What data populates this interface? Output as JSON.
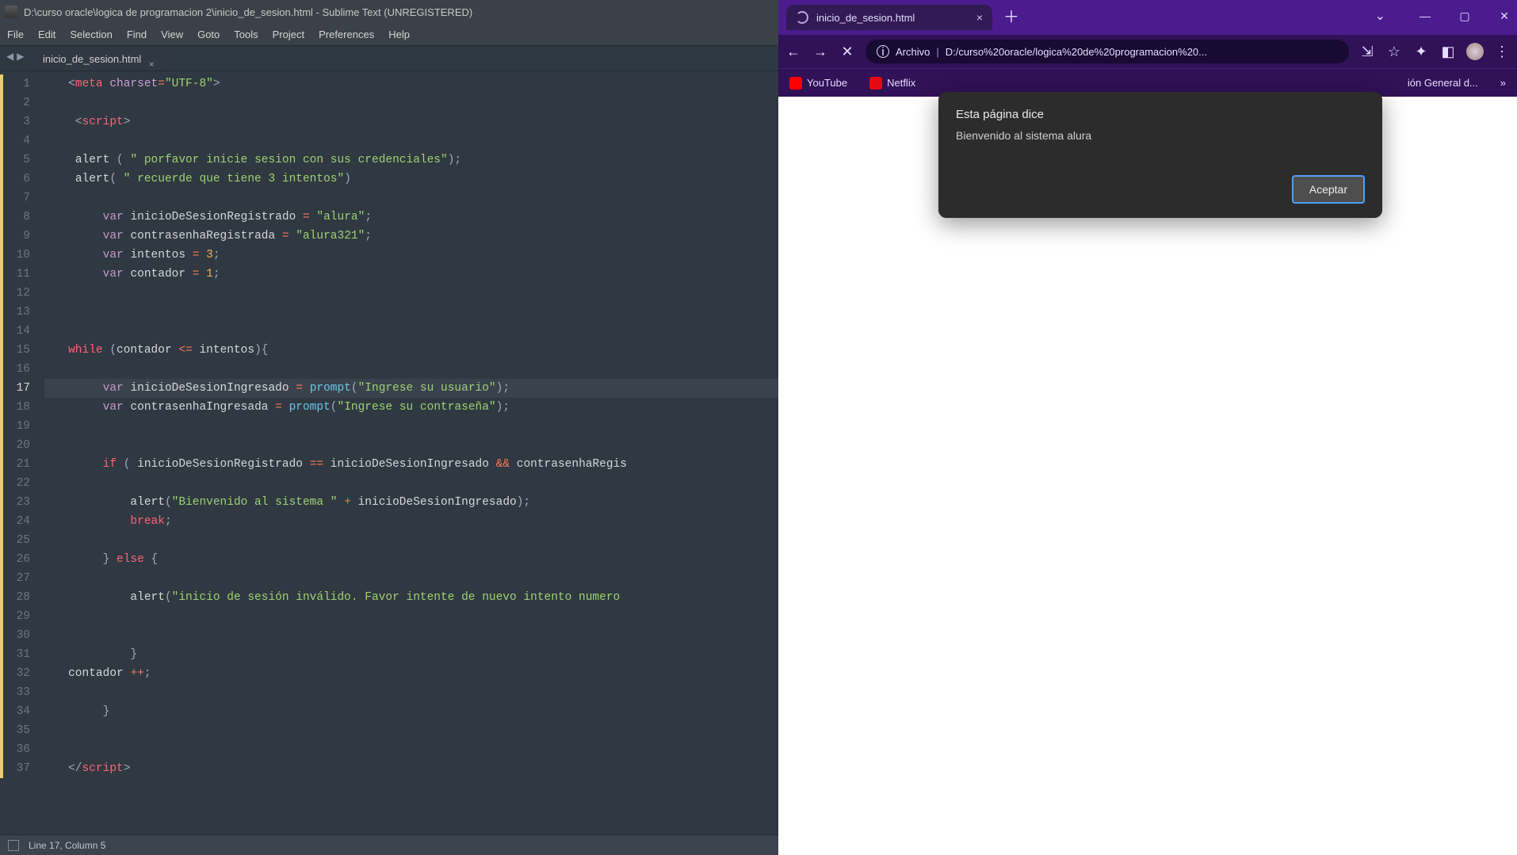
{
  "sublime": {
    "title": "D:\\curso oracle\\logica de programacion 2\\inicio_de_sesion.html - Sublime Text (UNREGISTERED)",
    "menus": [
      "File",
      "Edit",
      "Selection",
      "Find",
      "View",
      "Goto",
      "Tools",
      "Project",
      "Preferences",
      "Help"
    ],
    "tab_label": "inicio_de_sesion.html",
    "lines": 37,
    "current_line": 17,
    "mod_bars": [
      [
        1,
        8
      ],
      [
        9,
        15
      ],
      [
        16,
        17
      ],
      [
        18,
        37
      ]
    ],
    "status": {
      "cursor": "Line 17, Column 5"
    },
    "code": {
      "l1": {
        "indent": "   ",
        "parts": [
          [
            "<",
            "punc"
          ],
          [
            "meta",
            "tag"
          ],
          [
            " ",
            "punc"
          ],
          [
            "charset",
            "attr"
          ],
          [
            "=",
            "op"
          ],
          [
            "\"UTF-8\"",
            "str"
          ],
          [
            ">",
            "punc"
          ]
        ]
      },
      "l2": {
        "indent": "",
        "parts": []
      },
      "l3": {
        "indent": "    ",
        "parts": [
          [
            "<",
            "punc"
          ],
          [
            "script",
            "tag"
          ],
          [
            ">",
            "punc"
          ]
        ]
      },
      "l4": {
        "indent": "",
        "parts": []
      },
      "l5": {
        "indent": "    ",
        "parts": [
          [
            "alert",
            "ident"
          ],
          [
            " ( ",
            "punc"
          ],
          [
            "\" porfavor inicie sesion con sus credenciales\"",
            "str"
          ],
          [
            ");",
            "punc"
          ]
        ]
      },
      "l6": {
        "indent": "    ",
        "parts": [
          [
            "alert",
            "ident"
          ],
          [
            "( ",
            "punc"
          ],
          [
            "\" recuerde que tiene 3 intentos\"",
            "str"
          ],
          [
            ")",
            "punc"
          ]
        ]
      },
      "l7": {
        "indent": "",
        "parts": []
      },
      "l8": {
        "indent": "        ",
        "parts": [
          [
            "var",
            "kw"
          ],
          [
            " ",
            "punc"
          ],
          [
            "inicioDeSesionRegistrado",
            "ident"
          ],
          [
            " ",
            "punc"
          ],
          [
            "=",
            "op"
          ],
          [
            " ",
            "punc"
          ],
          [
            "\"alura\"",
            "str"
          ],
          [
            ";",
            "punc"
          ]
        ]
      },
      "l9": {
        "indent": "        ",
        "parts": [
          [
            "var",
            "kw"
          ],
          [
            " ",
            "punc"
          ],
          [
            "contrasenhaRegistrada",
            "ident"
          ],
          [
            " ",
            "punc"
          ],
          [
            "=",
            "op"
          ],
          [
            " ",
            "punc"
          ],
          [
            "\"alura321\"",
            "str"
          ],
          [
            ";",
            "punc"
          ]
        ]
      },
      "l10": {
        "indent": "        ",
        "parts": [
          [
            "var",
            "kw"
          ],
          [
            " ",
            "punc"
          ],
          [
            "intentos",
            "ident"
          ],
          [
            " ",
            "punc"
          ],
          [
            "=",
            "op"
          ],
          [
            " ",
            "punc"
          ],
          [
            "3",
            "num"
          ],
          [
            ";",
            "punc"
          ]
        ]
      },
      "l11": {
        "indent": "        ",
        "parts": [
          [
            "var",
            "kw"
          ],
          [
            " ",
            "punc"
          ],
          [
            "contador",
            "ident"
          ],
          [
            " ",
            "punc"
          ],
          [
            "=",
            "op"
          ],
          [
            " ",
            "punc"
          ],
          [
            "1",
            "num"
          ],
          [
            ";",
            "punc"
          ]
        ]
      },
      "l12": {
        "indent": "",
        "parts": []
      },
      "l13": {
        "indent": "",
        "parts": []
      },
      "l14": {
        "indent": "",
        "parts": []
      },
      "l15": {
        "indent": "   ",
        "parts": [
          [
            "while",
            "kw2"
          ],
          [
            " (",
            "punc"
          ],
          [
            "contador",
            "ident"
          ],
          [
            " ",
            "punc"
          ],
          [
            "<=",
            "op"
          ],
          [
            " ",
            "punc"
          ],
          [
            "intentos",
            "ident"
          ],
          [
            "){",
            "punc"
          ]
        ]
      },
      "l16": {
        "indent": "",
        "parts": []
      },
      "l17": {
        "indent": "        ",
        "parts": [
          [
            "var",
            "kw"
          ],
          [
            " ",
            "punc"
          ],
          [
            "inicioDeSesionIngresado",
            "ident"
          ],
          [
            " ",
            "punc"
          ],
          [
            "=",
            "op"
          ],
          [
            " ",
            "punc"
          ],
          [
            "prompt",
            "func"
          ],
          [
            "(",
            "punc"
          ],
          [
            "\"Ingrese su usuario\"",
            "str"
          ],
          [
            ");",
            "punc"
          ]
        ]
      },
      "l18": {
        "indent": "        ",
        "parts": [
          [
            "var",
            "kw"
          ],
          [
            " ",
            "punc"
          ],
          [
            "contrasenhaIngresada",
            "ident"
          ],
          [
            " ",
            "punc"
          ],
          [
            "=",
            "op"
          ],
          [
            " ",
            "punc"
          ],
          [
            "prompt",
            "func"
          ],
          [
            "(",
            "punc"
          ],
          [
            "\"Ingrese su contraseña\"",
            "str"
          ],
          [
            ");",
            "punc"
          ]
        ]
      },
      "l19": {
        "indent": "",
        "parts": []
      },
      "l20": {
        "indent": "",
        "parts": []
      },
      "l21": {
        "indent": "        ",
        "parts": [
          [
            "if",
            "kw2"
          ],
          [
            " ( ",
            "punc"
          ],
          [
            "inicioDeSesionRegistrado",
            "ident"
          ],
          [
            " ",
            "punc"
          ],
          [
            "==",
            "op"
          ],
          [
            " ",
            "punc"
          ],
          [
            "inicioDeSesionIngresado",
            "ident"
          ],
          [
            " ",
            "punc"
          ],
          [
            "&&",
            "op"
          ],
          [
            " ",
            "punc"
          ],
          [
            "contrasenhaRegis",
            "ident"
          ]
        ]
      },
      "l22": {
        "indent": "",
        "parts": []
      },
      "l23": {
        "indent": "            ",
        "parts": [
          [
            "alert",
            "ident"
          ],
          [
            "(",
            "punc"
          ],
          [
            "\"Bienvenido al sistema \"",
            "str"
          ],
          [
            " ",
            "punc"
          ],
          [
            "+",
            "op"
          ],
          [
            " ",
            "punc"
          ],
          [
            "inicioDeSesionIngresado",
            "ident"
          ],
          [
            ");",
            "punc"
          ]
        ]
      },
      "l24": {
        "indent": "            ",
        "parts": [
          [
            "break",
            "kw2"
          ],
          [
            ";",
            "punc"
          ]
        ]
      },
      "l25": {
        "indent": "",
        "parts": []
      },
      "l26": {
        "indent": "        ",
        "parts": [
          [
            "}",
            "punc"
          ],
          [
            " ",
            "punc"
          ],
          [
            "else",
            "kw2"
          ],
          [
            " {",
            "punc"
          ]
        ]
      },
      "l27": {
        "indent": "",
        "parts": []
      },
      "l28": {
        "indent": "            ",
        "parts": [
          [
            "alert",
            "ident"
          ],
          [
            "(",
            "punc"
          ],
          [
            "\"inicio de sesión inválido. Favor intente de nuevo intento numero ",
            "str"
          ]
        ]
      },
      "l29": {
        "indent": "",
        "parts": []
      },
      "l30": {
        "indent": "",
        "parts": []
      },
      "l31": {
        "indent": "            ",
        "parts": [
          [
            "}",
            "punc"
          ]
        ]
      },
      "l32": {
        "indent": "   ",
        "parts": [
          [
            "contador",
            "ident"
          ],
          [
            " ",
            "punc"
          ],
          [
            "++",
            "op"
          ],
          [
            ";",
            "punc"
          ]
        ]
      },
      "l33": {
        "indent": "",
        "parts": []
      },
      "l34": {
        "indent": "        ",
        "parts": [
          [
            "}",
            "punc"
          ]
        ]
      },
      "l35": {
        "indent": "",
        "parts": []
      },
      "l36": {
        "indent": "",
        "parts": []
      },
      "l37": {
        "indent": "   ",
        "parts": [
          [
            "</",
            "punc"
          ],
          [
            "script",
            "tag"
          ],
          [
            ">",
            "punc"
          ]
        ]
      }
    }
  },
  "browser": {
    "tab_label": "inicio_de_sesion.html",
    "address_scheme": "Archivo",
    "address_path": "D:/curso%20oracle/logica%20de%20programacion%20...",
    "bookmarks": [
      {
        "label": "YouTube",
        "icon": "youtube",
        "color": "#ff0000"
      },
      {
        "label": "Netflix",
        "icon": "netflix",
        "color": "#e50914"
      },
      {
        "label": "ión General d...",
        "icon": "folder",
        "color": "#8c60d5"
      }
    ],
    "alert": {
      "title": "Esta página dice",
      "body": "Bienvenido al sistema alura",
      "button": "Aceptar"
    }
  }
}
